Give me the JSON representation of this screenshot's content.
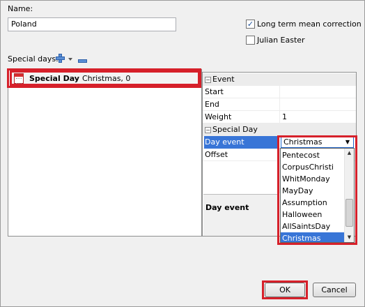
{
  "name": {
    "label": "Name:",
    "value": "Poland"
  },
  "options": {
    "long_term_mean_correction": {
      "label": "Long term mean correction",
      "checked": true
    },
    "julian_easter": {
      "label": "Julian Easter",
      "checked": false
    }
  },
  "special_days": {
    "label": "Special days:",
    "add_icon": "plus-icon",
    "menu_icon": "chevron-down-icon",
    "remove_icon": "minus-icon",
    "items": [
      {
        "icon": "calendar-icon",
        "title": "Special Day",
        "detail": "Christmas, 0"
      }
    ]
  },
  "property_grid": {
    "category_event": "Event",
    "start_label": "Start",
    "start_value": "",
    "end_label": "End",
    "end_value": "",
    "weight_label": "Weight",
    "weight_value": "1",
    "category_special_day": "Special Day",
    "day_event_label": "Day event",
    "day_event_value": "Christmas",
    "offset_label": "Offset",
    "offset_value": "",
    "description_title": "Day event"
  },
  "dropdown": {
    "options": [
      "Pentecost",
      "CorpusChristi",
      "WhitMonday",
      "MayDay",
      "Assumption",
      "Halloween",
      "AllSaintsDay",
      "Christmas"
    ],
    "selected": "Christmas"
  },
  "buttons": {
    "ok": "OK",
    "cancel": "Cancel"
  },
  "colors": {
    "highlight": "#d6202a",
    "selection": "#3875d7"
  }
}
